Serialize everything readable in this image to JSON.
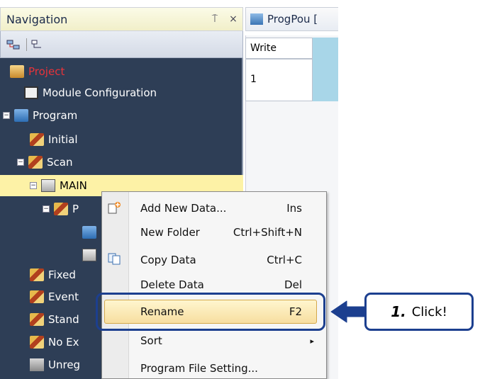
{
  "nav": {
    "title": "Navigation",
    "pin_glyph": "⍑",
    "close_glyph": "×"
  },
  "tree": {
    "project": "Project",
    "module_configuration": "Module Configuration",
    "program": "Program",
    "initial": "Initial",
    "scan": "Scan",
    "main": "MAIN",
    "pou_partial": "P",
    "fixed": "Fixed",
    "event": "Event",
    "standby": "Stand",
    "no_exec": "No Ex",
    "unreg": "Unreg",
    "project_color": "#e8333a"
  },
  "editor": {
    "tab_label": "ProgPou [",
    "column_header": "Write",
    "row_number": "1"
  },
  "context_menu": {
    "items": [
      {
        "label": "Add New Data...",
        "shortcut": "Ins"
      },
      {
        "label": "New Folder",
        "shortcut": "Ctrl+Shift+N"
      },
      {
        "label": "Copy Data",
        "shortcut": "Ctrl+C"
      },
      {
        "label": "Delete Data",
        "shortcut": "Del"
      },
      {
        "label": "Rename",
        "shortcut": "F2"
      },
      {
        "label": "Sort",
        "shortcut": "▸"
      },
      {
        "label": "Program File Setting...",
        "shortcut": ""
      }
    ]
  },
  "callout": {
    "step": "1.",
    "text": "Click!",
    "accent": "#1c3f8f"
  }
}
